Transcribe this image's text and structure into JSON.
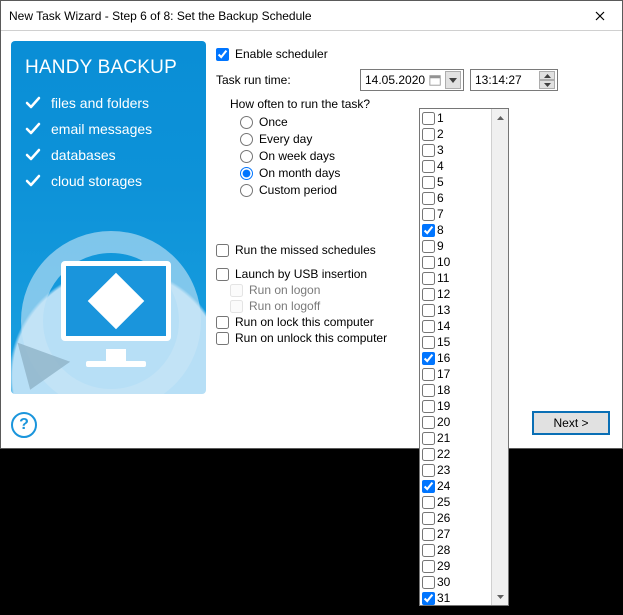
{
  "window": {
    "title": "New Task Wizard - Step 6 of 8: Set the Backup Schedule"
  },
  "sidebar": {
    "heading": "HANDY BACKUP",
    "features": [
      "files and folders",
      "email messages",
      "databases",
      "cloud storages"
    ]
  },
  "scheduler": {
    "enable_label": "Enable scheduler",
    "enable_checked": true,
    "runtime_label": "Task run time:",
    "date_value": "14.05.2020",
    "time_value": "13:14:27",
    "freq_question": "How often to run the task?",
    "options": {
      "once": "Once",
      "every_day": "Every day",
      "week_days": "On week days",
      "month_days": "On month days",
      "custom": "Custom period"
    },
    "selected": "month_days"
  },
  "extras": {
    "run_missed": {
      "label": "Run the missed schedules",
      "checked": false
    },
    "launchusb": {
      "label": "Launch by USB insertion",
      "checked": false
    },
    "logon": {
      "label": "Run on logon",
      "checked": false,
      "disabled": true
    },
    "logoff": {
      "label": "Run on logoff",
      "checked": false,
      "disabled": true
    },
    "lock": {
      "label": "Run on lock this computer",
      "checked": false
    },
    "unlock": {
      "label": "Run on unlock this computer",
      "checked": false
    }
  },
  "days": {
    "count": 31,
    "checked": [
      8,
      16,
      24,
      31
    ]
  },
  "buttons": {
    "next": "Next >"
  }
}
